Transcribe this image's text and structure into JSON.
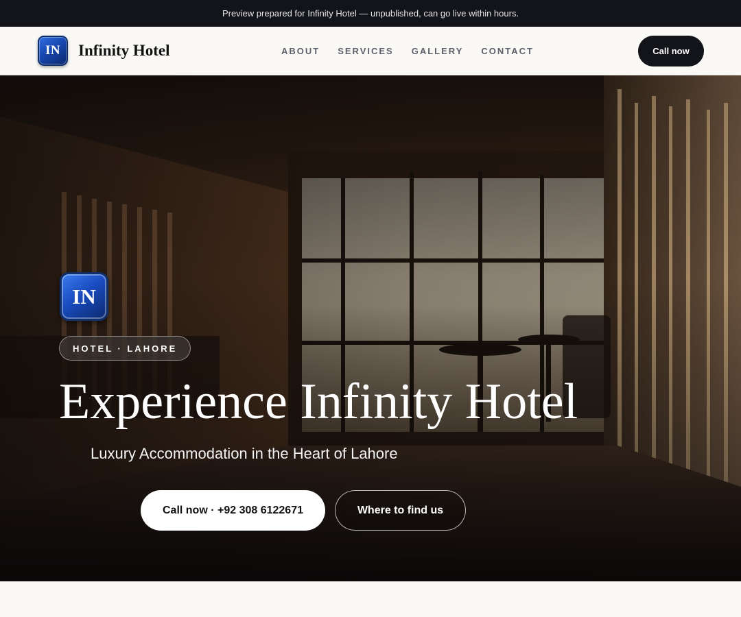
{
  "preview_banner": {
    "text": "Preview prepared for Infinity Hotel — unpublished, can go live within hours."
  },
  "header": {
    "logo_initials": "IN",
    "brand_name": "Infinity Hotel",
    "nav": [
      {
        "label": "ABOUT"
      },
      {
        "label": "SERVICES"
      },
      {
        "label": "GALLERY"
      },
      {
        "label": "CONTACT"
      }
    ],
    "cta_label": "Call now"
  },
  "hero": {
    "logo_initials": "IN",
    "tag": "HOTEL · LAHORE",
    "title": "Experience Infinity Hotel",
    "subtitle": "Luxury Accommodation in the Heart of Lahore",
    "primary_button": "Call now · +92 308 6122671",
    "secondary_button": "Where to find us",
    "background_image": "hotel-lobby-photo"
  },
  "colors": {
    "dark": "#121419",
    "page_bg": "#faf9f6",
    "logo_blue": "#1747b0",
    "nav_text": "#5c606a"
  }
}
